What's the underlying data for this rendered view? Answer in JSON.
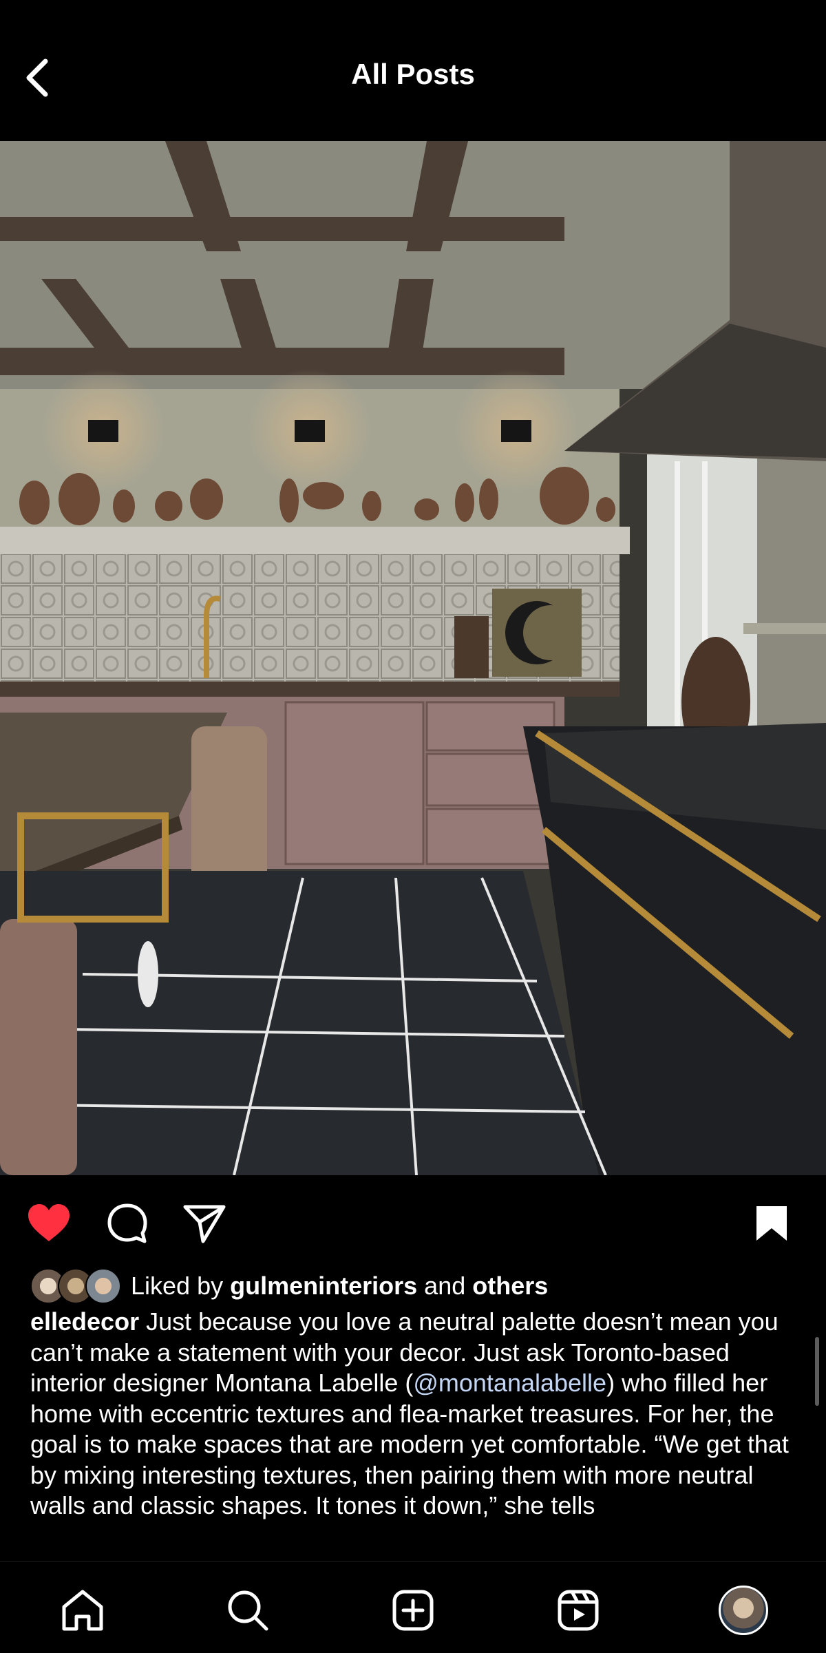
{
  "header": {
    "title": "All Posts"
  },
  "post": {
    "likes": {
      "prefix": "Liked by",
      "user": "gulmeninteriors",
      "and": "and",
      "others": "others"
    },
    "caption": {
      "username": "elledecor",
      "part1": "Just because you love a neutral palette doesn’t mean you can’t make a statement with your decor. Just ask Toronto-based interior designer Montana Labelle (",
      "mention": "@montanalabelle",
      "part2": ") who filled her home with eccentric textures and flea-market treasures. For her, the goal is to make spaces that are modern yet comfortable. “We get that by mixing interesting textures, then pairing them with more neutral walls and classic shapes. It tones it down,” she tells"
    }
  },
  "icons": {
    "back": "chevron-left-icon",
    "like": "heart-filled-icon",
    "comment": "comment-icon",
    "share": "paper-plane-icon",
    "save": "bookmark-filled-icon",
    "user_tag": "person-icon",
    "home": "home-icon",
    "search": "search-icon",
    "create": "plus-square-icon",
    "reels": "reels-icon"
  },
  "colors": {
    "background": "#000000",
    "like": "#ff3040",
    "mention": "#c4d6f5",
    "text": "#ffffff"
  }
}
